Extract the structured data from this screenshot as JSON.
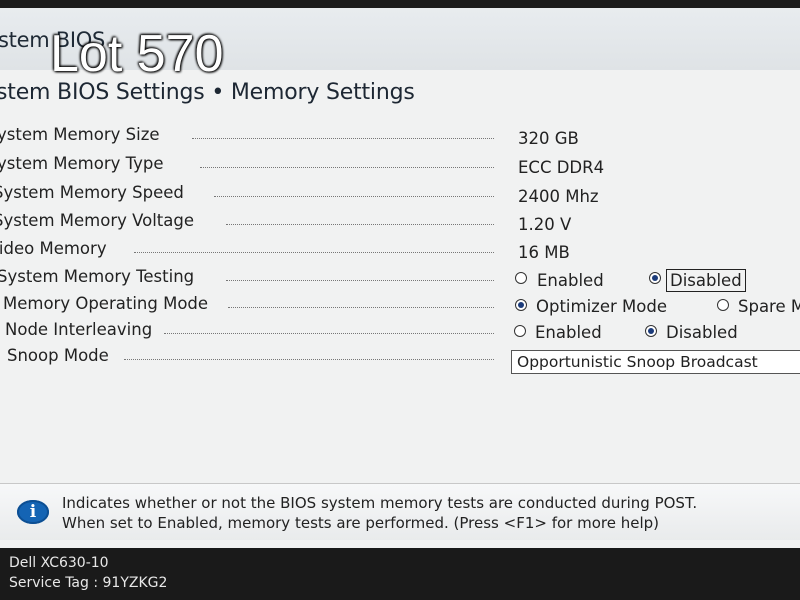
{
  "header": {
    "system_title": "stem BIOS",
    "watermark": "Lot 570"
  },
  "page_title": "stem BIOS Settings • Memory Settings",
  "settings": [
    {
      "label": "ystem Memory Size",
      "value": "320 GB"
    },
    {
      "label": "ystem Memory Type",
      "value": "ECC DDR4"
    },
    {
      "label": "System Memory Speed",
      "value": "2400 Mhz"
    },
    {
      "label": "System Memory Voltage",
      "value": "1.20 V"
    },
    {
      "label": "Video Memory",
      "value": "16 MB"
    },
    {
      "label": "System Memory Testing",
      "options": [
        "Enabled",
        "Disabled"
      ],
      "selected": "Disabled"
    },
    {
      "label": "Memory Operating Mode",
      "options": [
        "Optimizer Mode",
        "Spare M"
      ],
      "selected": "Optimizer Mode"
    },
    {
      "label": "Node Interleaving",
      "options": [
        "Enabled",
        "Disabled"
      ],
      "selected": "Disabled"
    },
    {
      "label": "Snoop Mode",
      "value": "Opportunistic Snoop Broadcast"
    }
  ],
  "help": {
    "icon": "info-icon",
    "line1": "Indicates whether or not the BIOS system memory tests are conducted during POST.",
    "line2": "When set to Enabled, memory tests are performed. (Press <F1> for more help)"
  },
  "footer": {
    "model": "Dell XC630-10",
    "service_tag": "Service Tag : 91YZKG2"
  },
  "colors": {
    "radio_selected": "#1b3b7a",
    "info_icon": "#1464b4",
    "footer_bg": "#1a1a1a"
  }
}
